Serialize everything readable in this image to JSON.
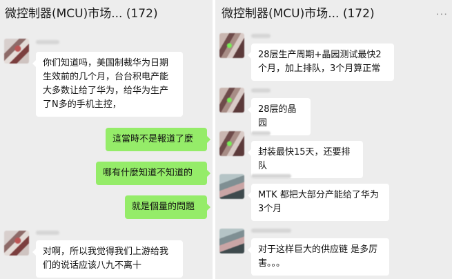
{
  "left_panel": {
    "title": "微控制器(MCU)市场... (172)",
    "messages": [
      {
        "type": "received",
        "text": "你们知道吗，美国制裁华为日期生效前的几个月，台台积电产能大多数让给了华为，给华为生产了N多的手机主控，",
        "avatar": "member-avatar-a"
      },
      {
        "type": "sent",
        "text": "這當時不是報道了麼"
      },
      {
        "type": "sent",
        "text": "哪有什麼知道不知道的"
      },
      {
        "type": "sent",
        "text": "就是個量的問題"
      },
      {
        "type": "received",
        "text": "对啊，所以我觉得我们上游给我们的说话应该八九不离十",
        "avatar": "member-avatar-a"
      }
    ]
  },
  "right_panel": {
    "title": "微控制器(MCU)市场... (172)",
    "more_icon": "···",
    "messages": [
      {
        "type": "received",
        "text": "28层生产周期+晶园测试最快2个月，加上排队，3个月算正常",
        "avatar": "member-avatar-b"
      },
      {
        "type": "received",
        "text": "28层的晶园",
        "avatar": "member-avatar-b"
      },
      {
        "type": "received",
        "text": "封装最快15天，还要排队",
        "avatar": "member-avatar-b"
      },
      {
        "type": "received",
        "text": "MTK 都把大部分产能给了华为3个月",
        "avatar": "member-avatar-c"
      },
      {
        "type": "received",
        "text": "对于这样巨大的供应链  是多厉害。。。",
        "avatar": "member-avatar-c"
      }
    ]
  },
  "colors": {
    "chat_background": "#ededed",
    "received_bubble": "#ffffff",
    "sent_bubble": "#95ec69"
  }
}
